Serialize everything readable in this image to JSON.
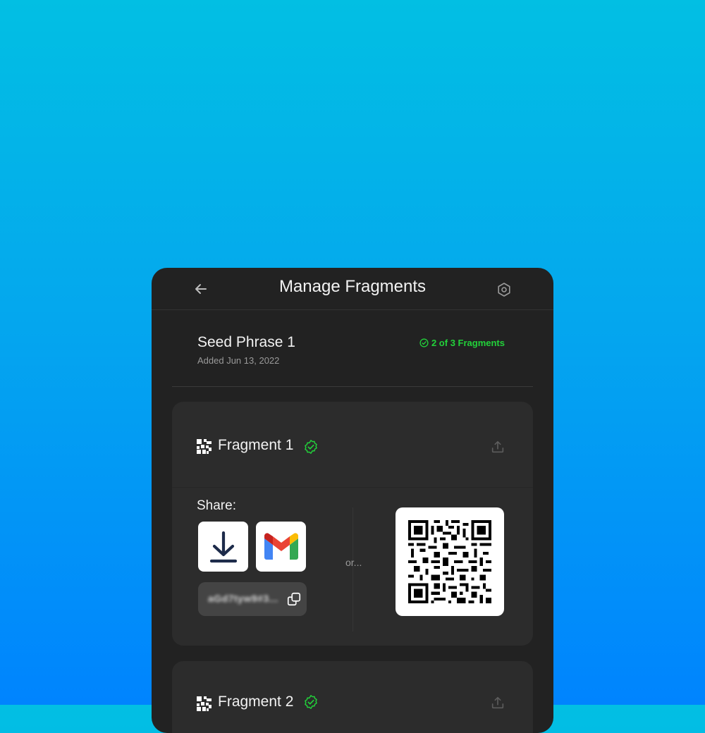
{
  "header": {
    "title": "Manage Fragments",
    "back_icon": "arrow-left-icon",
    "settings_icon": "hexagon-gear-icon"
  },
  "seed": {
    "name": "Seed Phrase 1",
    "added": "Added Jun 13, 2022",
    "status": "2 of 3 Fragments",
    "status_color": "#22d23a"
  },
  "fragments": [
    {
      "label": "Fragment 1",
      "verified": true,
      "share_label": "Share:",
      "share_options": [
        "download-icon",
        "gmail-icon"
      ],
      "secret_preview": "aGd7tyw9#3...",
      "or_label": "or..."
    },
    {
      "label": "Fragment 2",
      "verified": true
    }
  ],
  "colors": {
    "background_top": "#02bfe3",
    "background_bottom": "#0084fe",
    "panel": "#222222",
    "card": "#2c2c2c",
    "accent_green": "#22d23a"
  }
}
